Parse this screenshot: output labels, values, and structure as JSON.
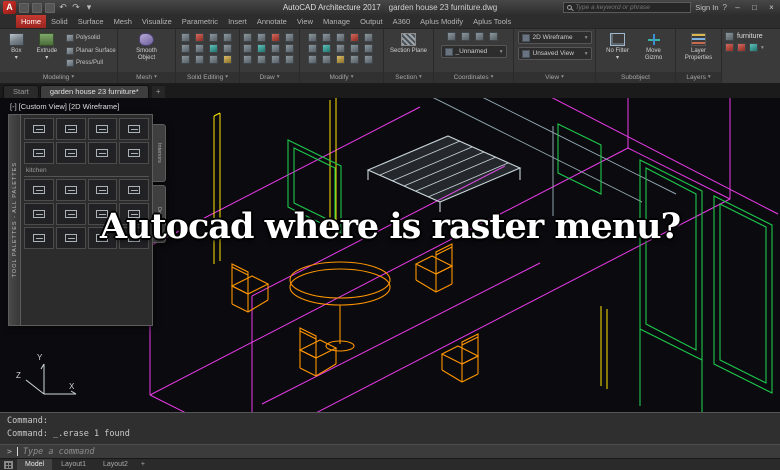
{
  "titlebar": {
    "logo_letter": "A",
    "app_title": "AutoCAD Architecture 2017",
    "doc_title": "garden house 23 furniture.dwg",
    "search_placeholder": "Type a keyword or phrase",
    "signin": "Sign In"
  },
  "icons": {
    "caret": "▾",
    "undo": "↶",
    "redo": "↷",
    "help": "?",
    "minimize": "–",
    "maximize": "□",
    "close": "×",
    "prompt": ">"
  },
  "tabs": {
    "items": [
      "Home",
      "Solid",
      "Surface",
      "Mesh",
      "Visualize",
      "Parametric",
      "Insert",
      "Annotate",
      "View",
      "Manage",
      "Output",
      "A360",
      "Aplus Modify",
      "Aplus Tools"
    ]
  },
  "ribbon": {
    "modeling": {
      "label": "Modeling",
      "box": "Box",
      "extrude": "Extrude",
      "polysolid": "Polysolid",
      "planar_surface": "Planar Surface",
      "press_pull": "Press/Pull"
    },
    "mesh": {
      "label": "Mesh",
      "smooth_object": "Smooth Object"
    },
    "solid_editing": {
      "label": "Solid Editing"
    },
    "draw": {
      "label": "Draw"
    },
    "modify": {
      "label": "Modify"
    },
    "section": {
      "label": "Section",
      "section_plane": "Section Plane"
    },
    "coordinates": {
      "label": "Coordinates",
      "unnamed": "_Unnamed"
    },
    "view": {
      "label": "View",
      "visual_style": "2D Wireframe",
      "saved_view": "Unsaved View"
    },
    "subobject": {
      "label": "Subobject",
      "no_filter": "No Filter",
      "move_gizmo": "Move Gizmo"
    },
    "layers": {
      "label": "Layers",
      "layer_properties": "Layer Properties"
    },
    "palette_group": {
      "furniture": "furniture"
    }
  },
  "file_tabs": {
    "start": "Start",
    "document": "garden house 23 furniture*",
    "new_tab": "+"
  },
  "viewport": {
    "menu": "[-]",
    "view_name": "[Custom View]",
    "style": "[2D Wireframe]"
  },
  "palette": {
    "title": "TOOL PALETTES - ALL PALETTES",
    "section": "kitchen",
    "tab1": "Interiors",
    "tab2": "Detail"
  },
  "ucs": {
    "x": "X",
    "y": "Y",
    "z": "Z"
  },
  "command": {
    "history1": "Command:",
    "history2": "Command: _.erase 1 found",
    "prompt": "Type a command"
  },
  "statusbar": {
    "model": "Model",
    "layout1": "Layout1",
    "layout2": "Layout2",
    "new_layout": "+"
  },
  "overlay": {
    "text": "Autocad where is raster menu?"
  },
  "colors": {
    "accent_red": "#b02420",
    "wire_magenta": "#e83ae8",
    "wire_orange": "#ff9500",
    "wire_green": "#1ec84b",
    "wire_yellow": "#ffe600",
    "wire_gray": "#8fa3ad"
  }
}
